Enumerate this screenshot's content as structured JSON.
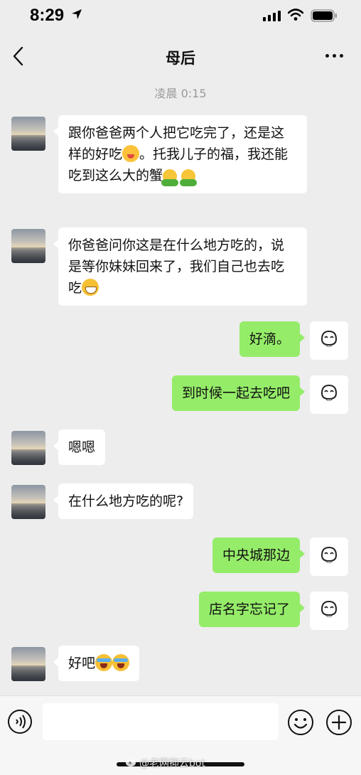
{
  "status_bar": {
    "time": "8:29",
    "icons": [
      "location-arrow-icon",
      "signal-icon",
      "wifi-icon",
      "battery-icon"
    ]
  },
  "nav": {
    "title": "母后",
    "back_icon": "chevron-left-icon",
    "more_icon": "more-dots-icon"
  },
  "chat": {
    "time_divider": "凌晨 0:15",
    "messages": [
      {
        "from": "them",
        "parts": [
          "跟你爸爸两个人把它吃完了，还是这样的好吃",
          "。托我儿子的福，我还能吃到这么大的蟹"
        ],
        "emojis": [
          "yum-emoji",
          "hug-emoji",
          "hug-emoji"
        ]
      },
      {
        "from": "them",
        "text": "你爸爸问你这是在什么地方吃的，说是等你妹妹回来了，我们自己也去吃吃",
        "emojis": [
          "grin-emoji"
        ]
      },
      {
        "from": "me",
        "text": "好滴。"
      },
      {
        "from": "me",
        "text": "到时候一起去吃吧"
      },
      {
        "from": "them",
        "text": "嗯嗯"
      },
      {
        "from": "them",
        "text": "在什么地方吃的呢?"
      },
      {
        "from": "me",
        "text": "中央城那边"
      },
      {
        "from": "me",
        "text": "店名字忘记了"
      },
      {
        "from": "them",
        "text": "好吧",
        "emojis": [
          "laughing-tears-emoji",
          "laughing-tears-emoji"
        ]
      }
    ]
  },
  "input_bar": {
    "input_value": "",
    "icons": [
      "voice-icon",
      "emoji-icon",
      "plus-icon"
    ]
  },
  "watermark": "@老网抑云bot",
  "colors": {
    "background": "#ededed",
    "incoming_bubble": "#ffffff",
    "outgoing_bubble": "#95ec69",
    "muted_text": "#9a9a9a"
  }
}
